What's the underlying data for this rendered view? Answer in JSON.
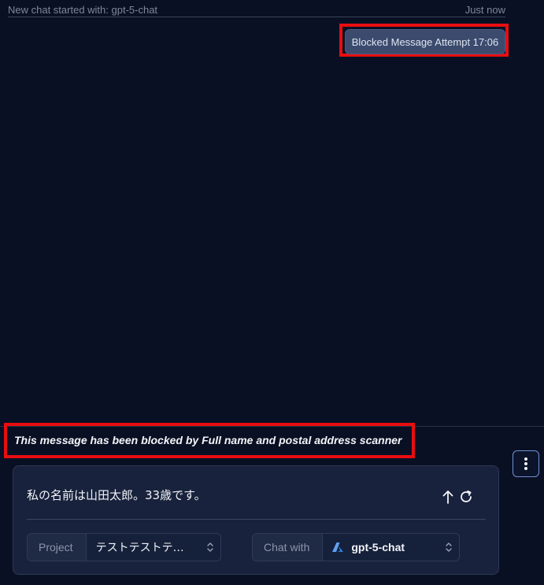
{
  "header": {
    "started_text": "New chat started with: gpt-5-chat",
    "time_text": "Just now"
  },
  "attempt": {
    "label": "Blocked Message Attempt 17:06"
  },
  "notice": {
    "text": "This message has been blocked by Full name and postal address scanner"
  },
  "composer": {
    "message": "私の名前は山田太郎。33歳です。",
    "project_label": "Project",
    "project_value": "テストテストテ…",
    "chat_label": "Chat with",
    "model_value": "gpt-5-chat"
  },
  "icons": {
    "send": "arrow-up-icon",
    "retry": "refresh-icon",
    "menu": "kebab-menu-icon",
    "model": "azure-logo-icon",
    "chevron": "chevron-up-down-icon"
  },
  "colors": {
    "background": "#0a1023",
    "highlight": "#e80d10",
    "bubble": "#3b4a6d",
    "composer": "#18223c",
    "menu_border": "#6f8fd6"
  }
}
